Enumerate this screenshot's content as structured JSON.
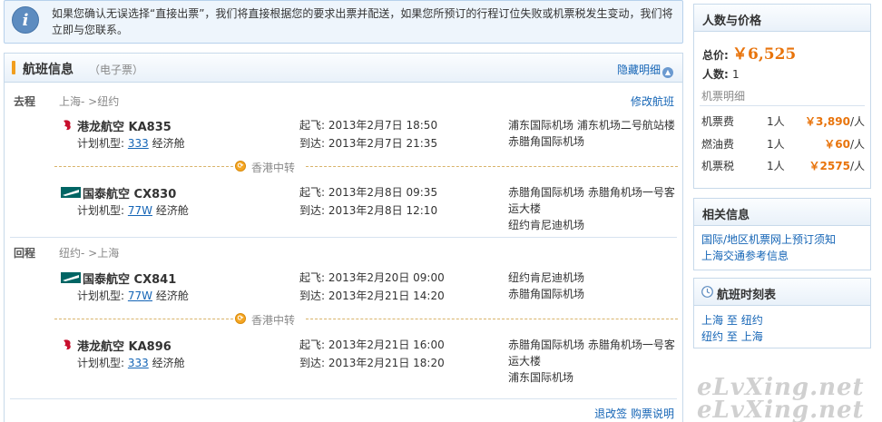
{
  "notice": {
    "icon": "info-icon",
    "text": "如果您确认无误选择“直接出票”，我们将直接根据您的要求出票并配送，如果您所预订的行程订位失败或机票税发生变动，我们将立即与您联系。"
  },
  "flight_panel": {
    "title": "航班信息",
    "subtitle": "（电子票）",
    "hide_details": "隐藏明细",
    "outbound": {
      "label": "去程",
      "route": "上海- >纽约",
      "modify": "修改航班",
      "legs": [
        {
          "airline": "港龙航空",
          "code": "KA835",
          "plane_prefix": "计划机型:",
          "plane": "333",
          "cabin": "经济舱",
          "dep_label": "起飞:",
          "dep_time": "2013年2月7日 18:50",
          "arr_label": "到达:",
          "arr_time": "2013年2月7日 21:35",
          "dep_airport": "浦东国际机场 浦东机场二号航站楼",
          "arr_airport": "赤腊角国际机场"
        },
        {
          "airline": "国泰航空",
          "code": "CX830",
          "plane_prefix": "计划机型:",
          "plane": "77W",
          "cabin": "经济舱",
          "dep_label": "起飞:",
          "dep_time": "2013年2月8日 09:35",
          "arr_label": "到达:",
          "arr_time": "2013年2月8日 12:10",
          "dep_airport": "赤腊角国际机场 赤腊角机场一号客运大楼",
          "arr_airport": "纽约肯尼迪机场"
        }
      ],
      "transfer": "香港中转"
    },
    "inbound": {
      "label": "回程",
      "route": "纽约- >上海",
      "legs": [
        {
          "airline": "国泰航空",
          "code": "CX841",
          "plane_prefix": "计划机型:",
          "plane": "77W",
          "cabin": "经济舱",
          "dep_label": "起飞:",
          "dep_time": "2013年2月20日 09:00",
          "arr_label": "到达:",
          "arr_time": "2013年2月21日 14:20",
          "dep_airport": "纽约肯尼迪机场",
          "arr_airport": "赤腊角国际机场"
        },
        {
          "airline": "港龙航空",
          "code": "KA896",
          "plane_prefix": "计划机型:",
          "plane": "333",
          "cabin": "经济舱",
          "dep_label": "起飞:",
          "dep_time": "2013年2月21日 16:00",
          "arr_label": "到达:",
          "arr_time": "2013年2月21日 18:20",
          "dep_airport": "赤腊角国际机场 赤腊角机场一号客运大楼",
          "arr_airport": "浦东国际机场"
        }
      ],
      "transfer": "香港中转"
    },
    "footer_link": "退改签 购票说明"
  },
  "price_box": {
    "title": "人数与价格",
    "total_label": "总价:",
    "total_value": "￥6,525",
    "people_label": "人数:",
    "people_value": "1",
    "detail_label": "机票明细",
    "fees": [
      {
        "name": "机票费",
        "count": "1人",
        "price": "￥3,890",
        "unit": "/人"
      },
      {
        "name": "燃油费",
        "count": "1人",
        "price": "￥60",
        "unit": "/人"
      },
      {
        "name": "机票税",
        "count": "1人",
        "price": "￥2575",
        "unit": "/人"
      }
    ]
  },
  "related_box": {
    "title": "相关信息",
    "links": [
      "国际/地区机票网上预订须知",
      "上海交通参考信息"
    ]
  },
  "schedule_box": {
    "title": "航班时刻表",
    "icon": "clock-icon",
    "links": [
      {
        "from": "上海",
        "to_word": "至",
        "to": "纽约"
      },
      {
        "from": "纽约",
        "to_word": "至",
        "to": "上海"
      }
    ]
  },
  "watermark": "eLvXing.net",
  "colors": {
    "accent_orange": "#e8740c",
    "link_blue": "#1565b6",
    "border": "#c7d9ea"
  }
}
